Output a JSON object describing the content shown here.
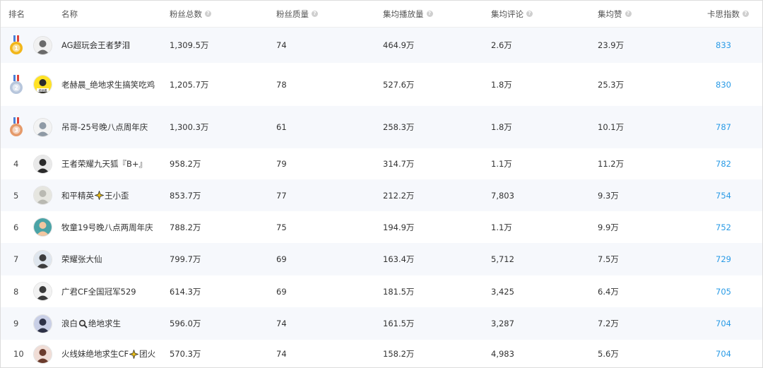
{
  "headers": {
    "rank": "排名",
    "name": "名称",
    "fans_total": "粉丝总数",
    "fans_quality": "粉丝质量",
    "avg_plays": "集均播放量",
    "avg_comments": "集均评论",
    "avg_likes": "集均赞",
    "kasi_index": "卡思指数"
  },
  "help_icon_name": "help-question-icon",
  "colors": {
    "kasi_link": "#2a9be6",
    "row_stripe": "#f6f8fc",
    "gold": "#f2b619",
    "silver": "#b7c6dc",
    "bronze": "#e59a6a",
    "ribbon_blue": "#4a7fd6",
    "ribbon_red": "#e0443a"
  },
  "rows": [
    {
      "rank": "1",
      "medal": "gold",
      "name": "AG超玩会王者梦泪",
      "fans_total": "1,309.5万",
      "fans_quality": "74",
      "avg_plays": "464.9万",
      "avg_comments": "2.6万",
      "avg_likes": "23.9万",
      "kasi_index": "833",
      "avatar_icon": "avatar-photo-icon"
    },
    {
      "rank": "2",
      "medal": "silver",
      "name": "老赫晨_绝地求生搞笑吃鸡",
      "fans_total": "1,205.7万",
      "fans_quality": "78",
      "avg_plays": "527.6万",
      "avg_comments": "1.8万",
      "avg_likes": "25.3万",
      "kasi_index": "830",
      "avatar_icon": "avatar-cartoon-yellow-icon",
      "avatar_text": "老赫晨"
    },
    {
      "rank": "3",
      "medal": "bronze",
      "name": "吊哥-25号晚八点周年庆",
      "fans_total": "1,300.3万",
      "fans_quality": "61",
      "avg_plays": "258.3万",
      "avg_comments": "1.8万",
      "avg_likes": "10.1万",
      "kasi_index": "787",
      "avatar_icon": "avatar-cartoon-gray-icon"
    },
    {
      "rank": "4",
      "name": "王者荣耀九天狐『B+』",
      "fans_total": "958.2万",
      "fans_quality": "79",
      "avg_plays": "314.7万",
      "avg_comments": "1.1万",
      "avg_likes": "11.2万",
      "kasi_index": "782",
      "avatar_icon": "avatar-dark-hat-icon"
    },
    {
      "rank": "5",
      "name": "和平精英",
      "name_suffix": "王小歪",
      "name_emoji_icon": "sparkle-emoji-icon",
      "fans_total": "853.7万",
      "fans_quality": "77",
      "avg_plays": "212.2万",
      "avg_comments": "7,803",
      "avg_likes": "9.3万",
      "kasi_index": "754",
      "avatar_icon": "avatar-polar-bear-icon"
    },
    {
      "rank": "6",
      "name": "牧童19号晚八点两周年庆",
      "fans_total": "788.2万",
      "fans_quality": "75",
      "avg_plays": "194.9万",
      "avg_comments": "1.1万",
      "avg_likes": "9.9万",
      "kasi_index": "752",
      "avatar_icon": "avatar-teal-anime-icon"
    },
    {
      "rank": "7",
      "name": "荣耀张大仙",
      "fans_total": "799.7万",
      "fans_quality": "69",
      "avg_plays": "163.4万",
      "avg_comments": "5,712",
      "avg_likes": "7.5万",
      "kasi_index": "729",
      "avatar_icon": "avatar-photo-standing-icon"
    },
    {
      "rank": "8",
      "name": "广君CF全国冠军529",
      "fans_total": "614.3万",
      "fans_quality": "69",
      "avg_plays": "181.5万",
      "avg_comments": "3,425",
      "avg_likes": "6.4万",
      "kasi_index": "705",
      "avatar_icon": "avatar-sketch-icon"
    },
    {
      "rank": "9",
      "name": "浪白",
      "name_suffix": "绝地求生",
      "name_emoji_icon": "magnifier-emoji-icon",
      "fans_total": "596.0万",
      "fans_quality": "74",
      "avg_plays": "161.5万",
      "avg_comments": "3,287",
      "avg_likes": "7.2万",
      "kasi_index": "704",
      "avatar_icon": "avatar-anime-boy-icon"
    },
    {
      "rank": "10",
      "name": "火线妹绝地求生CF",
      "name_suffix": "团火",
      "name_emoji_icon": "sparkle-emoji-icon",
      "fans_total": "570.3万",
      "fans_quality": "74",
      "avg_plays": "158.2万",
      "avg_comments": "4,983",
      "avg_likes": "5.6万",
      "kasi_index": "704",
      "avatar_icon": "avatar-girl-photo-icon"
    }
  ]
}
